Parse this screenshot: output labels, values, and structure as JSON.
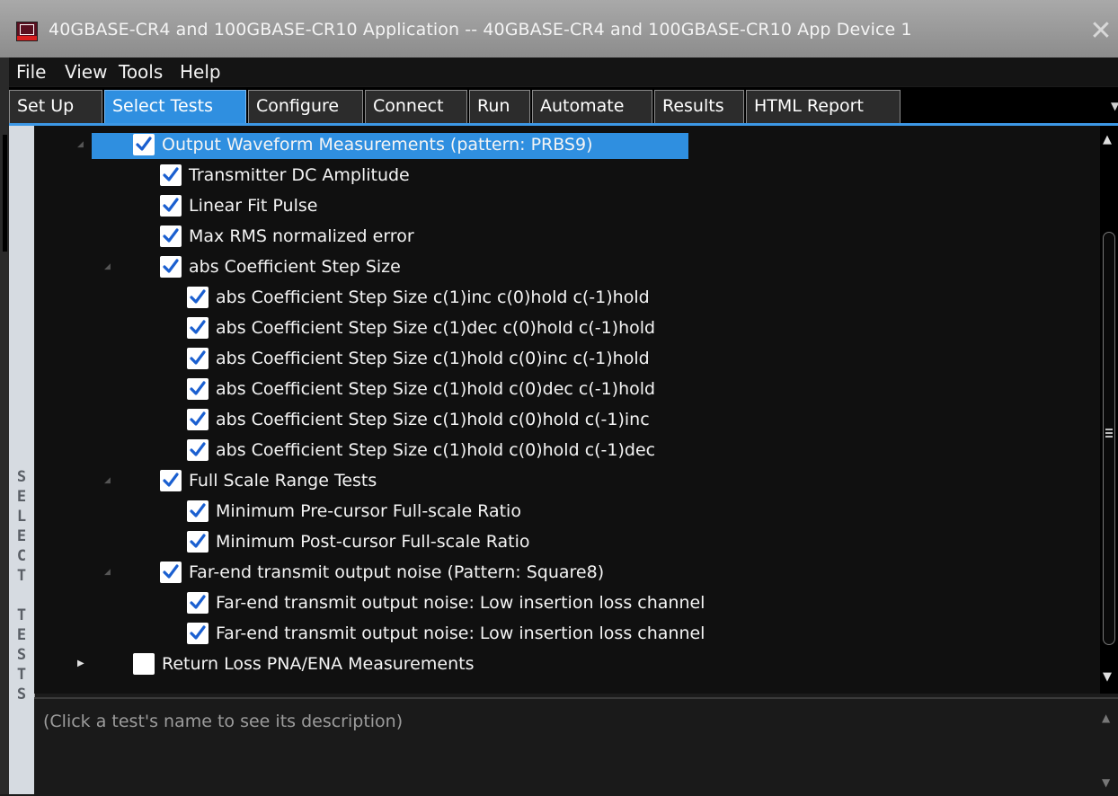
{
  "window": {
    "title": "40GBASE-CR4 and 100GBASE-CR10 Application -- 40GBASE-CR4 and 100GBASE-CR10 App Device 1"
  },
  "menu": [
    "File",
    "View",
    "Tools",
    "Help"
  ],
  "tabs": [
    {
      "label": "Set Up"
    },
    {
      "label": "Select Tests"
    },
    {
      "label": "Configure"
    },
    {
      "label": "Connect"
    },
    {
      "label": "Run"
    },
    {
      "label": "Automate"
    },
    {
      "label": "Results"
    },
    {
      "label": "HTML Report"
    }
  ],
  "active_tab": "Select Tests",
  "side_label": "SELECT TESTS",
  "tree": [
    {
      "label": "Output Waveform Measurements (pattern: PRBS9)",
      "checked": true
    },
    {
      "label": "Transmitter DC Amplitude",
      "checked": true
    },
    {
      "label": "Linear Fit Pulse",
      "checked": true
    },
    {
      "label": "Max RMS normalized error",
      "checked": true
    },
    {
      "label": "abs Coefficient Step Size",
      "checked": true
    },
    {
      "label": "abs Coefficient Step Size c(1)inc c(0)hold c(-1)hold",
      "checked": true
    },
    {
      "label": "abs Coefficient Step Size c(1)dec c(0)hold c(-1)hold",
      "checked": true
    },
    {
      "label": "abs Coefficient Step Size c(1)hold c(0)inc c(-1)hold",
      "checked": true
    },
    {
      "label": "abs Coefficient Step Size c(1)hold c(0)dec c(-1)hold",
      "checked": true
    },
    {
      "label": "abs Coefficient Step Size c(1)hold c(0)hold c(-1)inc",
      "checked": true
    },
    {
      "label": "abs Coefficient Step Size c(1)hold c(0)hold c(-1)dec",
      "checked": true
    },
    {
      "label": "Full Scale Range Tests",
      "checked": true
    },
    {
      "label": "Minimum Pre-cursor Full-scale Ratio",
      "checked": true
    },
    {
      "label": "Minimum Post-cursor Full-scale Ratio",
      "checked": true
    },
    {
      "label": "Far-end transmit output noise (Pattern: Square8)",
      "checked": true
    },
    {
      "label": "Far-end transmit output noise: Low insertion loss channel",
      "checked": true
    },
    {
      "label": "Far-end transmit output noise: Low insertion loss channel",
      "checked": true
    },
    {
      "label": "Return Loss PNA/ENA Measurements",
      "checked": false
    }
  ],
  "description": "(Click a test's name to see its description)",
  "colors": {
    "accent": "#2f8fe0",
    "background": "#101010",
    "checkmark": "#1a5fd0"
  },
  "icons": {
    "app": "app-logo-icon",
    "close": "close-icon",
    "check": "checkmark-icon",
    "expander": "triangle-expander-icon"
  }
}
